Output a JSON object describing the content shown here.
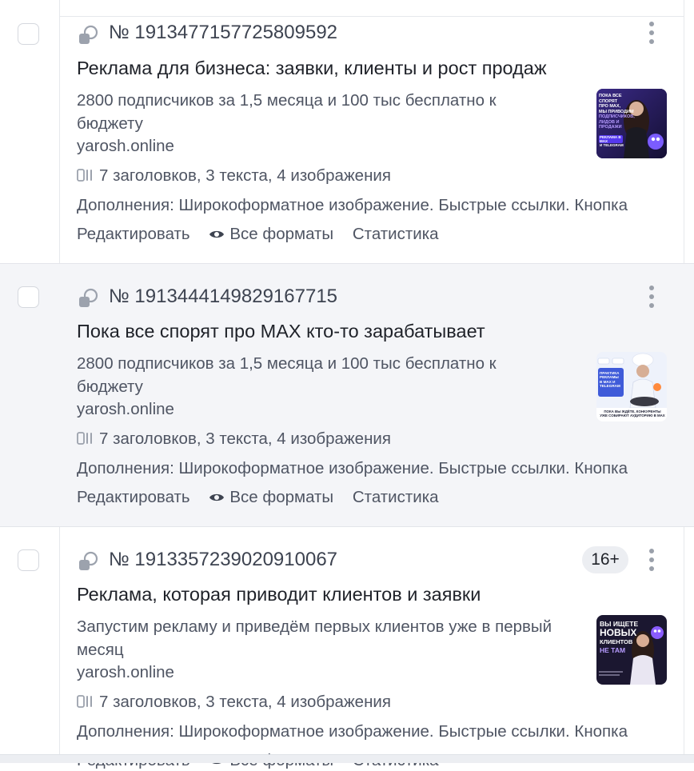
{
  "ads": [
    {
      "number": "№ 1913477157725809592",
      "title": "Реклама для бизнеса: заявки, клиенты и рост продаж",
      "text": "2800 подписчиков за 1,5 месяца и 100 тыс бесплатно к бюджету",
      "domain": "yarosh.online",
      "assets": "7 заголовков, 3 текста, 4 изображения",
      "extras": "Дополнения: Широкоформатное изображение. Быстрые ссылки. Кнопка",
      "actions": {
        "edit": "Редактировать",
        "formats": "Все форматы",
        "stats": "Статистика"
      },
      "age_badge": "",
      "thumb": {
        "lines": [
          "ПОКА ВСЕ СПОРЯТ",
          "ПРО MAX,",
          "МЫ ПРИВОДИМ",
          "ПОДПИСЧИКОВ,",
          "ЛИДОВ И ПРОДАЖИ",
          "РЕКЛАМА В MAX",
          "И TELEGRAM"
        ],
        "colors": {
          "bg": "#2a1f5e",
          "accent": "#7b5cff",
          "text": "#ffffff"
        }
      }
    },
    {
      "number": "№ 1913444149829167715",
      "title": "Пока все спорят про MAX кто-то зарабатывает",
      "text": "2800 подписчиков за 1,5 месяца и 100 тыс бесплатно к бюджету",
      "domain": "yarosh.online",
      "assets": "7 заголовков, 3 текста, 4 изображения",
      "extras": "Дополнения: Широкоформатное изображение. Быстрые ссылки. Кнопка",
      "actions": {
        "edit": "Редактировать",
        "formats": "Все форматы",
        "stats": "Статистика"
      },
      "age_badge": "",
      "thumb": {
        "lines": [
          "ПРАКТИКА",
          "РЕКЛАМЫ",
          "В MAX И",
          "TELEGRAM",
          "ПОКА ВЫ ЖДЁТЕ, КОНКУРЕНТЫ",
          "УЖЕ СОБИРАЮТ АУДИТОРИЮ В MAX"
        ],
        "colors": {
          "bg": "#eef2fb",
          "accent": "#3f5bd9",
          "text": "#1d1f33"
        }
      }
    },
    {
      "number": "№ 1913357239020910067",
      "title": "Реклама, которая приводит клиентов и заявки",
      "text": "Запустим рекламу и приведём первых клиентов уже в первый месяц",
      "domain": "yarosh.online",
      "assets": "7 заголовков, 3 текста, 4 изображения",
      "extras": "Дополнения: Широкоформатное изображение. Быстрые ссылки. Кнопка",
      "actions": {
        "edit": "Редактировать",
        "formats": "Все форматы",
        "stats": "Статистика"
      },
      "age_badge": "16+",
      "thumb": {
        "lines": [
          "ВЫ ИЩЕТЕ",
          "НОВЫХ",
          "КЛИЕНТОВ",
          "НЕ ТАМ"
        ],
        "colors": {
          "bg": "#1b1730",
          "accent": "#8a5cff",
          "text": "#ffffff"
        }
      }
    }
  ],
  "icons": {
    "ad_type": "multi-format-ad-icon",
    "assets": "assets-icon",
    "formats": "eye-icon",
    "menu": "more-vertical-icon"
  },
  "colors": {
    "highlight_row": "#f4f5f8",
    "text_primary": "#1f2229",
    "text_secondary": "#4f5563",
    "divider": "#e3e5ea"
  }
}
